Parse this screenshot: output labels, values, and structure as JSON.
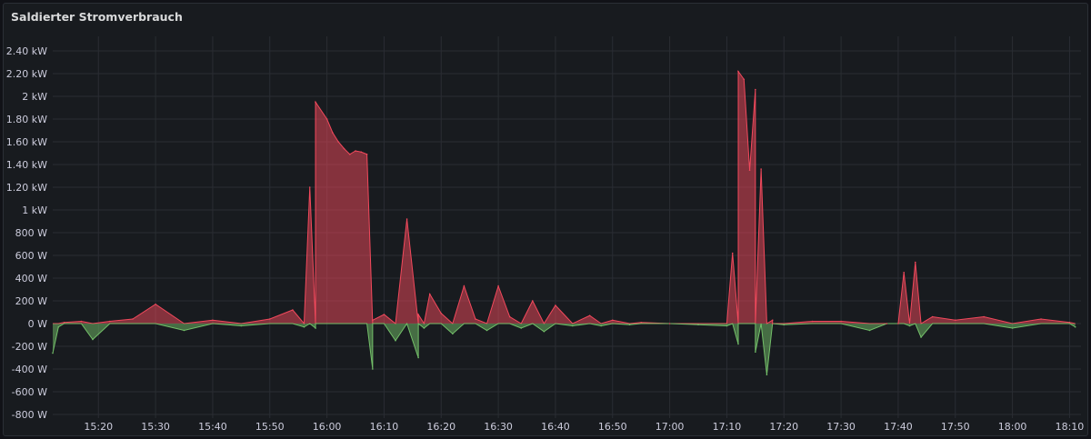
{
  "panel": {
    "title": "Saldierter Stromverbrauch"
  },
  "chart_data": {
    "type": "area",
    "title": "Saldierter Stromverbrauch",
    "xlabel": "",
    "ylabel": "",
    "x_range": [
      "15:12",
      "18:12"
    ],
    "ylim": [
      -800,
      2500
    ],
    "y_ticks": [
      {
        "value": 2400,
        "label": "2.40 kW"
      },
      {
        "value": 2200,
        "label": "2.20 kW"
      },
      {
        "value": 2000,
        "label": "2 kW"
      },
      {
        "value": 1800,
        "label": "1.80 kW"
      },
      {
        "value": 1600,
        "label": "1.60 kW"
      },
      {
        "value": 1400,
        "label": "1.40 kW"
      },
      {
        "value": 1200,
        "label": "1.20 kW"
      },
      {
        "value": 1000,
        "label": "1 kW"
      },
      {
        "value": 800,
        "label": "800 W"
      },
      {
        "value": 600,
        "label": "600 W"
      },
      {
        "value": 400,
        "label": "400 W"
      },
      {
        "value": 200,
        "label": "200 W"
      },
      {
        "value": 0,
        "label": "0 W"
      },
      {
        "value": -200,
        "label": "-200 W"
      },
      {
        "value": -400,
        "label": "-400 W"
      },
      {
        "value": -600,
        "label": "-600 W"
      },
      {
        "value": -800,
        "label": "-800 W"
      }
    ],
    "x_ticks": [
      "15:20",
      "15:30",
      "15:40",
      "15:50",
      "16:00",
      "16:10",
      "16:20",
      "16:30",
      "16:40",
      "16:50",
      "17:00",
      "17:10",
      "17:20",
      "17:30",
      "17:40",
      "17:50",
      "18:00",
      "18:10"
    ],
    "grid": true,
    "colors": {
      "import": "#f2495c",
      "export": "#73bf69"
    },
    "series": [
      {
        "unit": "W",
        "x": [
          "15:12",
          "15:13",
          "15:14",
          "15:17",
          "15:19",
          "15:22",
          "15:26",
          "15:30",
          "15:35",
          "15:40",
          "15:45",
          "15:50",
          "15:54",
          "15:56",
          "15:57",
          "15:58",
          "15:58",
          "16:00",
          "16:01",
          "16:02",
          "16:03",
          "16:04",
          "16:05",
          "16:06",
          "16:07",
          "16:08",
          "16:08",
          "16:10",
          "16:12",
          "16:14",
          "16:16",
          "16:16",
          "16:17",
          "16:18",
          "16:20",
          "16:22",
          "16:24",
          "16:26",
          "16:28",
          "16:30",
          "16:32",
          "16:34",
          "16:36",
          "16:38",
          "16:40",
          "16:43",
          "16:46",
          "16:48",
          "16:50",
          "16:53",
          "16:55",
          "17:00",
          "17:05",
          "17:10",
          "17:11",
          "17:12",
          "17:12",
          "17:13",
          "17:14",
          "17:15",
          "17:15",
          "17:16",
          "17:17",
          "17:18",
          "17:18",
          "17:20",
          "17:25",
          "17:30",
          "17:35",
          "17:38",
          "17:40",
          "17:41",
          "17:42",
          "17:43",
          "17:44",
          "17:46",
          "17:50",
          "17:55",
          "18:00",
          "18:05",
          "18:10",
          "18:11"
        ],
        "values": [
          -260,
          -30,
          10,
          20,
          -140,
          20,
          40,
          170,
          -60,
          30,
          -20,
          40,
          120,
          -30,
          1200,
          -40,
          1950,
          1800,
          1680,
          1600,
          1540,
          1490,
          1520,
          1510,
          1490,
          -400,
          30,
          80,
          -150,
          920,
          -300,
          80,
          -40,
          260,
          90,
          -90,
          330,
          40,
          -60,
          330,
          60,
          -40,
          200,
          -70,
          160,
          -20,
          70,
          -20,
          30,
          -10,
          10,
          0,
          -10,
          -20,
          620,
          -180,
          2220,
          2150,
          1350,
          2060,
          -250,
          1360,
          -450,
          30,
          0,
          -10,
          20,
          20,
          -60,
          0,
          0,
          450,
          -20,
          540,
          -120,
          60,
          30,
          60,
          -40,
          40,
          10,
          -30
        ]
      }
    ]
  }
}
